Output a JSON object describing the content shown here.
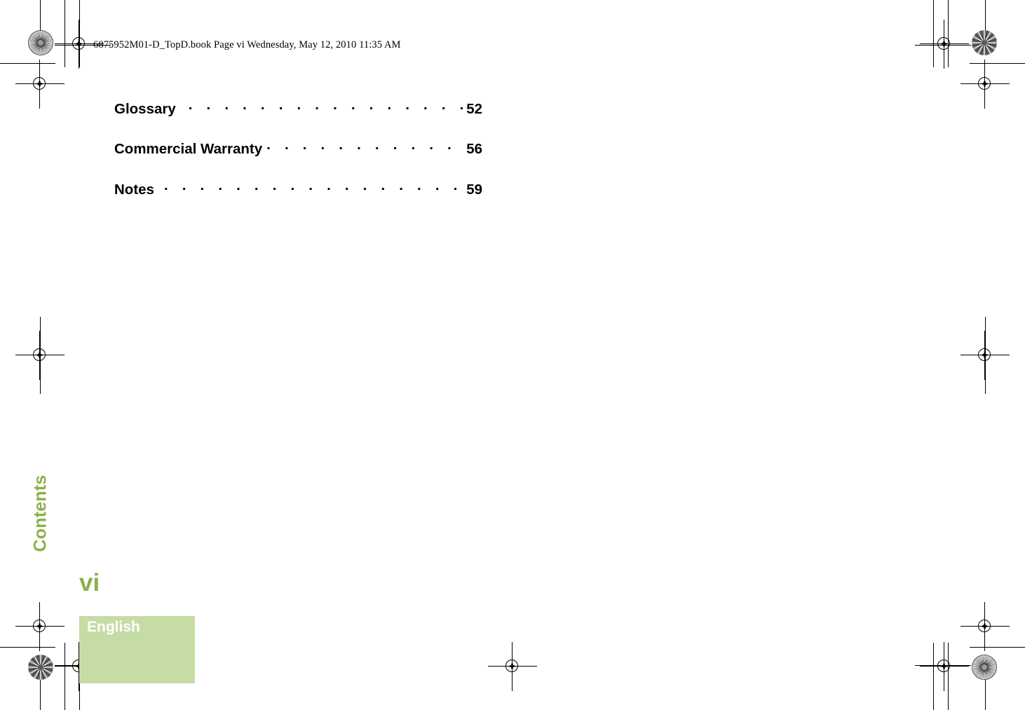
{
  "document": {
    "header_text": "6875952M01-D_TopD.book  Page vi  Wednesday, May 12, 2010  11:35 AM",
    "section_label": "Contents",
    "folio": "vi",
    "language_label": "English"
  },
  "toc": {
    "entries": [
      {
        "title": "Glossary",
        "page": "52",
        "leader": ". . . . . . . . . . . . . . . . . . . . . . . . . . . . ."
      },
      {
        "title": "Commercial Warranty",
        "page": "56",
        "leader": ". . . . . . . . . . . . . . . . . . . . . . ."
      },
      {
        "title": "Notes",
        "page": "59",
        "leader": ". . . . . . . . . . . . . . . . . . . . . . . . . . . . . ."
      }
    ]
  },
  "colors": {
    "accent_green_text": "#8CB04A",
    "language_block_green": "#C6DCA5",
    "language_label_text": "#FFFFFF",
    "body_text": "#000000"
  },
  "print_marks": {
    "registration_target_icon": "registration-target-icon",
    "starburst_density_icon": "starburst-density-icon",
    "crop_line_icon": "crop-line-icon"
  }
}
